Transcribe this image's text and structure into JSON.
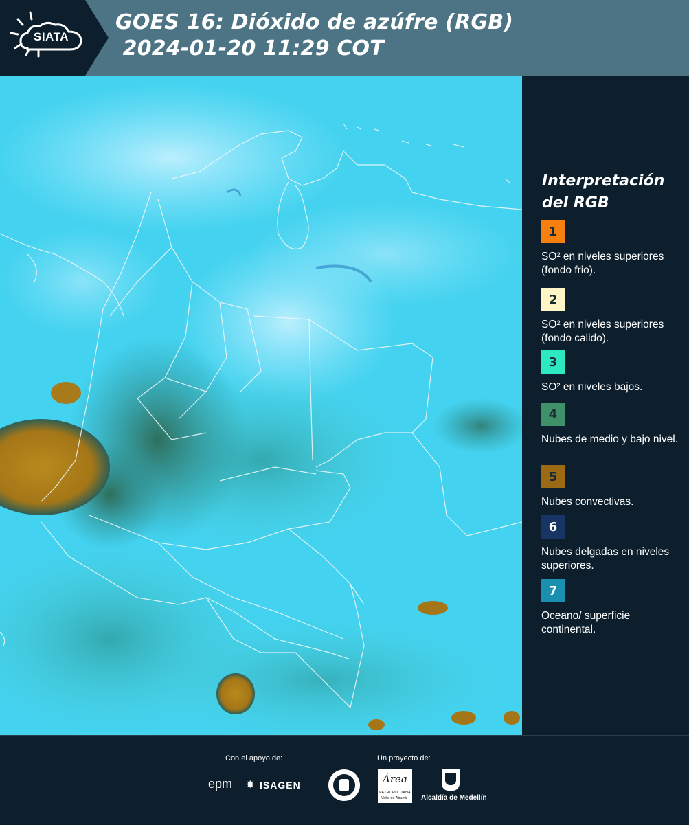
{
  "header": {
    "logo_text": "SIATA",
    "title_line1": "GOES 16: Dióxido de azúfre (RGB)",
    "title_line2": " 2024-01-20 11:29 COT"
  },
  "legend": {
    "title_line1": "Interpretación",
    "title_line2": "del RGB",
    "items": [
      {
        "num": "1",
        "color": "#f77f0d",
        "text": "SO² en niveles superiores (fondo frio)."
      },
      {
        "num": "2",
        "color": "#fef7c5",
        "text": "SO² en niveles superiores (fondo calido)."
      },
      {
        "num": "3",
        "color": "#2ee8c2",
        "text": "SO² en niveles bajos."
      },
      {
        "num": "4",
        "color": "#3e9168",
        "text": "Nubes de medio y bajo nivel."
      },
      {
        "num": "5",
        "color": "#9c6a14",
        "text": "Nubes convectivas."
      },
      {
        "num": "6",
        "color": "#173465",
        "text": "Nubes delgadas en niveles superiores."
      },
      {
        "num": "7",
        "color": "#1a8fb0",
        "text": "Oceano/ superficie continental."
      }
    ]
  },
  "footer": {
    "support_label": "Con el apoyo de:",
    "project_label": "Un proyecto de:",
    "sponsor_epm": "epm",
    "sponsor_isagen": "ISAGEN",
    "area_name": "Área",
    "area_sub1": "METROPOLITANA",
    "area_sub2": "Valle de Aburrá",
    "alcaldia": "Alcaldía de Medellín"
  }
}
